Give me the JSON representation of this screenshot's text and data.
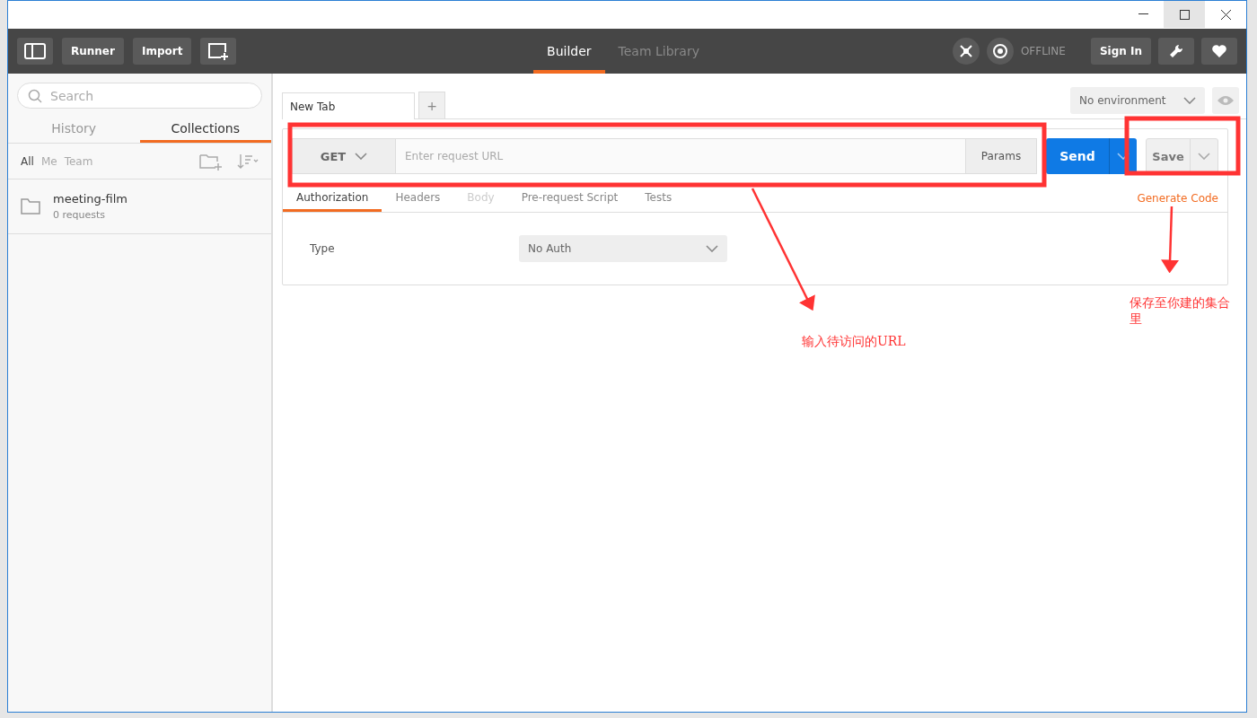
{
  "header": {
    "buttons": [
      "Runner",
      "Import"
    ],
    "tabs": [
      {
        "label": "Builder",
        "selected": true
      },
      {
        "label": "Team Library",
        "selected": false
      }
    ],
    "status": "OFFLINE",
    "sign_in": "Sign In"
  },
  "sidebar": {
    "search": {
      "placeholder": "Search"
    },
    "tabs": [
      {
        "label": "History",
        "selected": false
      },
      {
        "label": "Collections",
        "selected": true
      }
    ],
    "filters": [
      {
        "label": "All",
        "selected": true
      },
      {
        "label": "Me",
        "selected": false
      },
      {
        "label": "Team",
        "selected": false
      }
    ],
    "collections": [
      {
        "name": "meeting-film",
        "count": "0 requests"
      }
    ]
  },
  "request_tabs": [
    {
      "label": "New Tab",
      "selected": true
    }
  ],
  "add_tab": "+",
  "environment": "No environment",
  "request": {
    "method": "GET",
    "url": {
      "placeholder": "Enter request URL"
    },
    "params": "Params",
    "send": "Send",
    "save": "Save"
  },
  "subtabs": [
    {
      "label": "Authorization",
      "selected": true,
      "disabled": false
    },
    {
      "label": "Headers",
      "selected": false,
      "disabled": false
    },
    {
      "label": "Body",
      "selected": false,
      "disabled": true
    },
    {
      "label": "Pre-request Script",
      "selected": false,
      "disabled": false
    },
    {
      "label": "Tests",
      "selected": false,
      "disabled": false
    }
  ],
  "generate_code": "Generate Code",
  "auth": {
    "label": "Type",
    "value": "No Auth"
  },
  "annotations": [
    {
      "text": "输入待访问的URL"
    },
    {
      "text": "保存至你建的集合里"
    }
  ]
}
